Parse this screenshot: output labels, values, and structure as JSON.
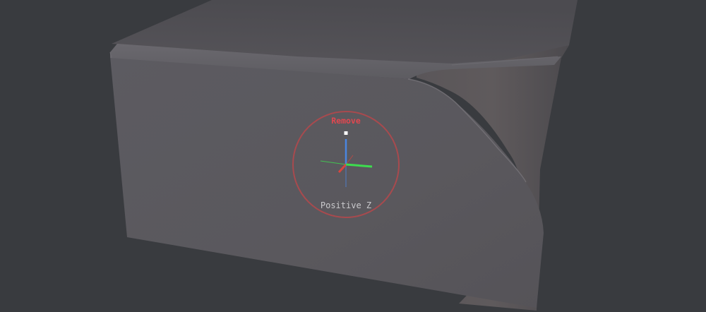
{
  "viewport": {
    "background": "#393b3f",
    "object": "3d-box-mesh"
  },
  "gizmo": {
    "remove_label": "Remove",
    "direction_label": "Positive Z",
    "ring_color": "#a84a4e",
    "remove_color": "#e2474f",
    "axes": [
      {
        "name": "x-axis",
        "color": "#d9453e"
      },
      {
        "name": "y-axis",
        "color": "#3ddc4f"
      },
      {
        "name": "z-axis",
        "color": "#4a86e0"
      }
    ]
  }
}
